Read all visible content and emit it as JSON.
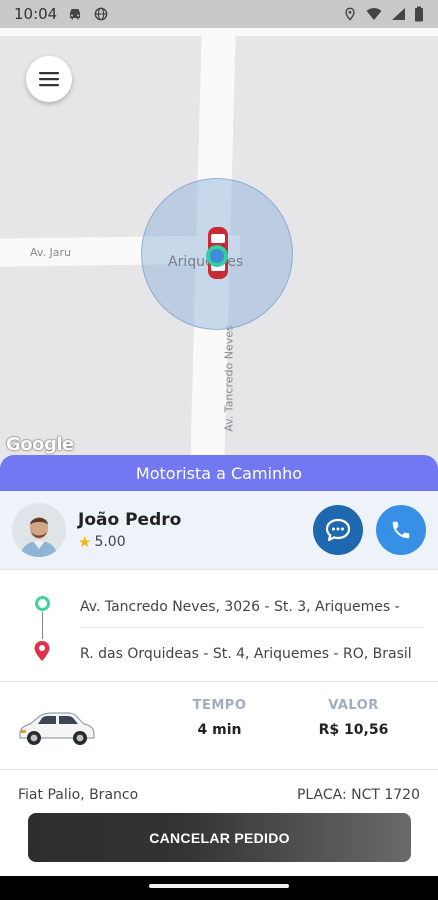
{
  "status_bar": {
    "time": "10:04",
    "left_icons": [
      "car-icon",
      "globe-icon"
    ],
    "right_icons": [
      "location-icon",
      "wifi-icon",
      "signal-icon",
      "battery-icon"
    ]
  },
  "map": {
    "street_jaru": "Av. Jaru",
    "city": "Ariquemes",
    "street_tancredo": "Av. Tancredo Neves",
    "attribution": "Google"
  },
  "sheet": {
    "header": "Motorista a Caminho",
    "driver": {
      "name": "João Pedro",
      "rating": "5.00"
    },
    "route": {
      "origin": "Av. Tancredo Neves, 3026 - St. 3, Ariquemes -",
      "destination": "R. das Orquideas - St. 4, Ariquemes - RO, Brasil"
    },
    "trip": {
      "time_label": "TEMPO",
      "time_value": "4 min",
      "price_label": "VALOR",
      "price_value": "R$ 10,56"
    },
    "vehicle": {
      "model": "Fiat Palio, Branco",
      "plate": "PLACA: NCT 1720"
    },
    "cancel_label": "CANCELAR PEDIDO"
  },
  "colors": {
    "header": "#7277f2",
    "chat_button": "#1e68b0",
    "call_button": "#3790e6",
    "origin_pin": "#3ed49e",
    "destination_pin": "#e0334b",
    "star": "#f1b80c"
  }
}
